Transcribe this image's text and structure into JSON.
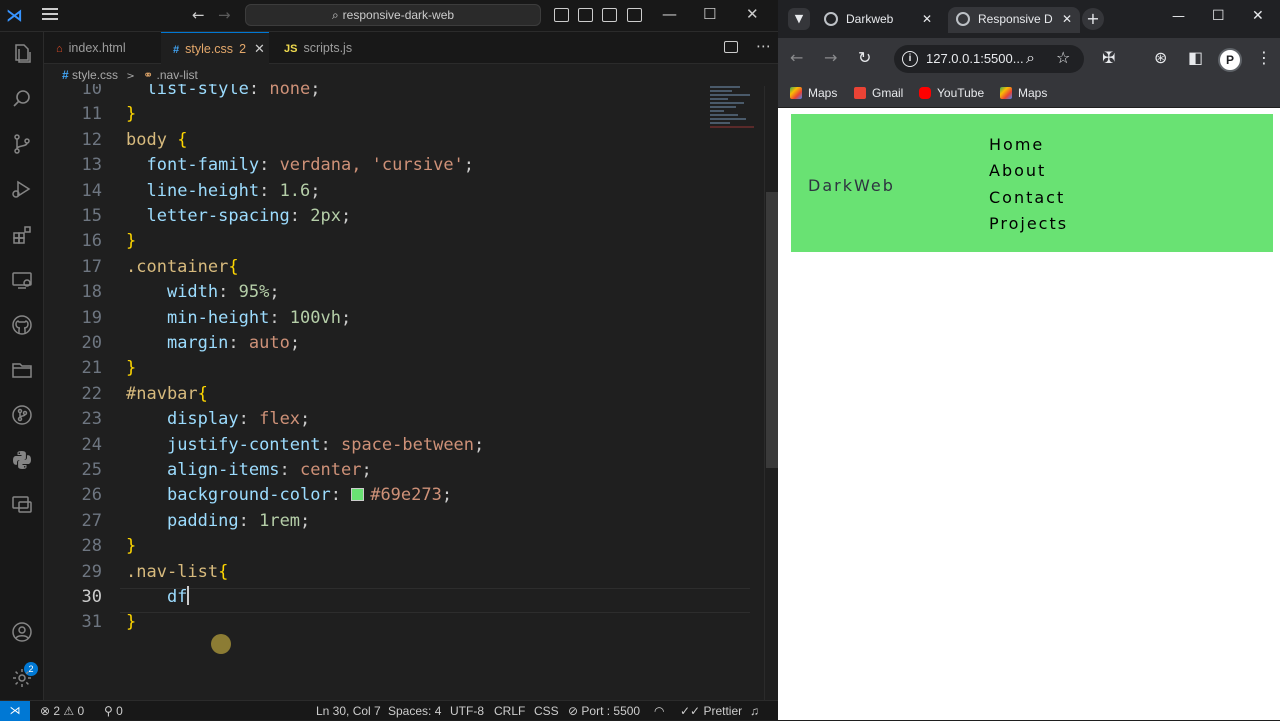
{
  "vscode": {
    "command_center": "responsive-dark-web",
    "tabs": [
      {
        "label": "index.html",
        "icon": "html-file-icon"
      },
      {
        "label": "style.css",
        "icon": "css-file-icon",
        "modified": "2"
      },
      {
        "label": "scripts.js",
        "icon": "js-file-icon"
      }
    ],
    "breadcrumb": {
      "file": "style.css",
      "symbol": ".nav-list"
    },
    "editor": {
      "lines": [
        {
          "n": "10",
          "t": "  list-style: none;"
        },
        {
          "n": "11",
          "t": "}"
        },
        {
          "n": "12",
          "t": "body {"
        },
        {
          "n": "13",
          "t": "  font-family: verdana, 'cursive';"
        },
        {
          "n": "14",
          "t": "  line-height: 1.6;"
        },
        {
          "n": "15",
          "t": "  letter-spacing: 2px;"
        },
        {
          "n": "16",
          "t": "}"
        },
        {
          "n": "17",
          "t": ".container{"
        },
        {
          "n": "18",
          "t": "    width: 95%;"
        },
        {
          "n": "19",
          "t": "    min-height: 100vh;"
        },
        {
          "n": "20",
          "t": "    margin: auto;"
        },
        {
          "n": "21",
          "t": "}"
        },
        {
          "n": "22",
          "t": "#navbar{"
        },
        {
          "n": "23",
          "t": "    display: flex;"
        },
        {
          "n": "24",
          "t": "    justify-content: space-between;"
        },
        {
          "n": "25",
          "t": "    align-items: center;"
        },
        {
          "n": "26",
          "t": "    background-color: #69e273;"
        },
        {
          "n": "27",
          "t": "    padding: 1rem;"
        },
        {
          "n": "28",
          "t": "}"
        },
        {
          "n": "29",
          "t": ".nav-list{"
        },
        {
          "n": "30",
          "t": "    df"
        },
        {
          "n": "31",
          "t": "}"
        }
      ],
      "swatch_color": "#69e273"
    },
    "activity_icons": [
      "explorer-icon",
      "search-icon",
      "source-control-icon",
      "run-debug-icon",
      "extensions-icon",
      "remote-explorer-icon",
      "github-icon",
      "folder-icon",
      "git-graph-icon",
      "python-icon",
      "remote-monitor-icon",
      "account-icon",
      "settings-gear-icon"
    ],
    "account_badge": "2",
    "status": {
      "errors": "2",
      "warnings": "0",
      "ports": "0",
      "position": "Ln 30, Col 7",
      "spaces": "Spaces: 4",
      "encoding": "UTF-8",
      "eol": "CRLF",
      "language": "CSS",
      "live_server": "Port : 5500",
      "formatter": "Prettier"
    }
  },
  "chrome": {
    "tabs": [
      {
        "label": "Darkweb"
      },
      {
        "label": "Responsive D"
      }
    ],
    "address": "127.0.0.1:5500...",
    "profile_initial": "P",
    "bookmarks": [
      {
        "label": "Maps",
        "icon": "maps-icon"
      },
      {
        "label": "Gmail",
        "icon": "gmail-icon"
      },
      {
        "label": "YouTube",
        "icon": "youtube-icon"
      },
      {
        "label": "Maps",
        "icon": "maps-icon"
      }
    ]
  },
  "site": {
    "brand": "DarkWeb",
    "nav_items": [
      "Home",
      "About",
      "Contact",
      "Projects"
    ],
    "navbar_color": "#69e273"
  }
}
